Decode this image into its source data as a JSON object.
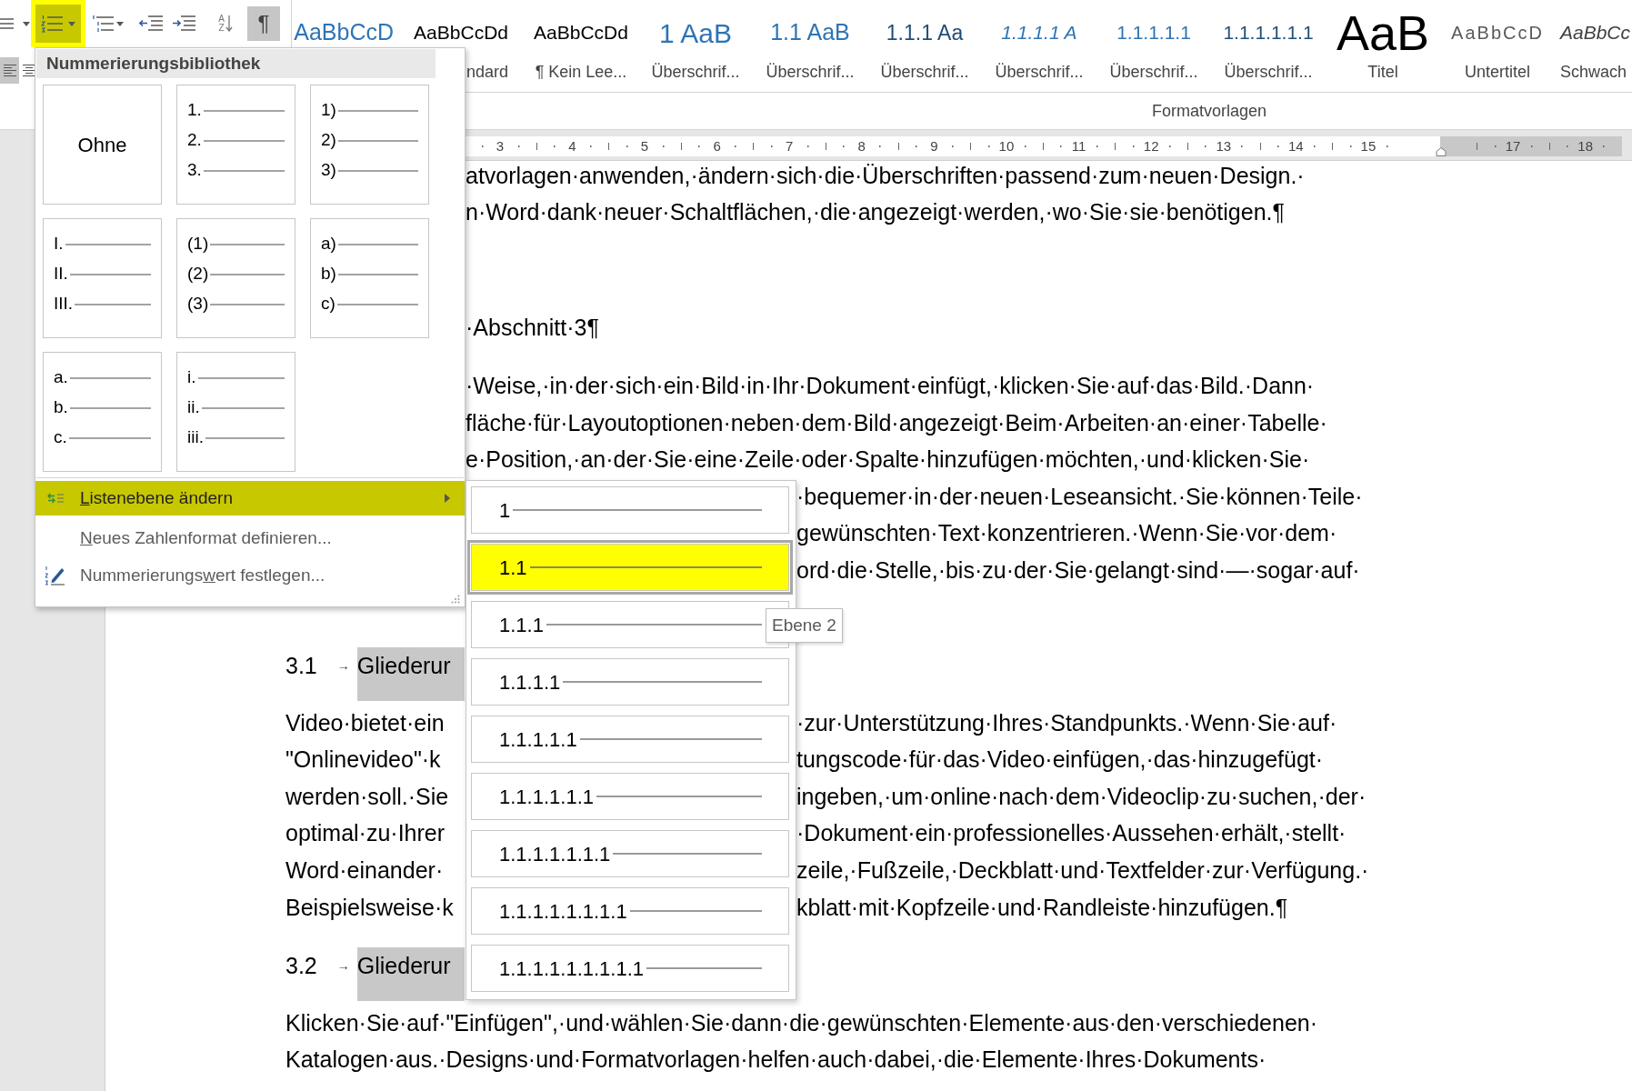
{
  "ribbon": {
    "row_1": [
      {
        "kind": "bullets",
        "on": false
      },
      {
        "kind": "numbering",
        "on": true
      },
      {
        "kind": "multilevel",
        "on": false
      },
      {
        "kind": "decrease-indent",
        "on": false
      },
      {
        "kind": "increase-indent",
        "on": false
      },
      {
        "kind": "sort",
        "on": false,
        "letters": [
          "A",
          "Z"
        ]
      },
      {
        "kind": "show-marks",
        "on": true,
        "glyph": "¶"
      }
    ],
    "row_2": [
      {
        "kind": "align-left",
        "on": true
      },
      {
        "kind": "align-center",
        "on": false
      }
    ],
    "styles": [
      {
        "kind": "accent-light",
        "preview": "AaBbCcD",
        "selected": false
      },
      {
        "kind": "body",
        "preview": "AaBbCcDd",
        "label": "ndard",
        "selected": false
      },
      {
        "kind": "body",
        "preview": "AaBbCcDd",
        "label": "¶ Kein Lee...",
        "selected": false
      },
      {
        "kind": "heading-1",
        "preview": "1 AaB",
        "label": "Überschrif...",
        "selected": false
      },
      {
        "kind": "heading-2",
        "preview": "1.1 AaB",
        "label": "Überschrif...",
        "selected": false
      },
      {
        "kind": "heading-3",
        "preview": "1.1.1 Aa",
        "label": "Überschrif...",
        "selected": false
      },
      {
        "kind": "heading-4",
        "preview": "1.1.1.1 A",
        "label": "Überschrif...",
        "selected": false
      },
      {
        "kind": "heading-5",
        "preview": "1.1.1.1.1",
        "label": "Überschrif...",
        "selected": false
      },
      {
        "kind": "heading-6",
        "preview": "1.1.1.1.1.1",
        "label": "Überschrif...",
        "selected": false
      },
      {
        "kind": "title",
        "preview": "AaB",
        "label": "Titel",
        "selected": false
      },
      {
        "kind": "subtitle",
        "preview": "AaBbCcD",
        "label": "Untertitel",
        "selected": false
      },
      {
        "kind": "subtle-emphasis",
        "preview": "AaBbCc",
        "label": "Schwach",
        "selected": false
      }
    ],
    "group_label": "Formatvorlagen"
  },
  "ruler": {
    "marks": [
      {
        "kind": "number",
        "label": "3",
        "margin": false
      },
      {
        "kind": "number",
        "label": "4",
        "margin": false
      },
      {
        "kind": "number",
        "label": "5",
        "margin": false
      },
      {
        "kind": "number",
        "label": "6",
        "margin": false
      },
      {
        "kind": "number",
        "label": "7",
        "margin": false
      },
      {
        "kind": "number",
        "label": "8",
        "margin": false
      },
      {
        "kind": "number",
        "label": "9",
        "margin": false
      },
      {
        "kind": "number",
        "label": "10",
        "margin": false
      },
      {
        "kind": "number",
        "label": "11",
        "margin": false
      },
      {
        "kind": "number",
        "label": "12",
        "margin": false
      },
      {
        "kind": "number",
        "label": "13",
        "margin": false
      },
      {
        "kind": "number",
        "label": "14",
        "margin": false
      },
      {
        "kind": "number",
        "label": "15",
        "margin": false
      },
      {
        "kind": "indent-marker",
        "margin": true
      },
      {
        "kind": "number",
        "label": "17",
        "margin": true
      },
      {
        "kind": "number",
        "label": "18",
        "margin": true
      }
    ]
  },
  "document": {
    "blocks": [
      {
        "kind": "paragraph",
        "lines": [
          {
            "right": "atvorlagen·anwenden,·ändern·sich·die·Überschriften·passend·zum·neuen·Design.·"
          },
          {
            "right": "n·Word·dank·neuer·Schaltflächen,·die·angezeigt·werden,·wo·Sie·sie·benötigen.¶"
          }
        ]
      },
      {
        "kind": "heading",
        "lines": [
          {
            "right": "·Abschnitt·3¶"
          }
        ]
      },
      {
        "kind": "paragraph",
        "lines": [
          {
            "right": "·Weise,·in·der·sich·ein·Bild·in·Ihr·Dokument·einfügt,·klicken·Sie·auf·das·Bild.·Dann·"
          },
          {
            "right": "fläche·für·Layoutoptionen·neben·dem·Bild·angezeigt·Beim·Arbeiten·an·einer·Tabelle·"
          },
          {
            "right": "e·Position,·an·der·Sie·eine·Zeile·oder·Spalte·hinzufügen·möchten,·und·klicken·Sie·"
          },
          {
            "right": "·bequemer·in·der·neuen·Leseansicht.·Sie·können·Teile·"
          },
          {
            "right": "gewünschten·Text·konzentrieren.·Wenn·Sie·vor·dem·"
          },
          {
            "right": "ord·die·Stelle,·bis·zu·der·Sie·gelangt·sind·—·sogar·auf·"
          }
        ]
      },
      {
        "kind": "heading",
        "number": "3.1",
        "tab": "→",
        "title": "Gliederur"
      },
      {
        "kind": "paragraph",
        "lines": [
          {
            "left": "Video·bietet·ein",
            "right": "·zur·Unterstützung·Ihres·Standpunkts.·Wenn·Sie·auf·"
          },
          {
            "left": "\"Onlinevideo\"·k",
            "right": "tungscode·für·das·Video·einfügen,·das·hinzugefügt·"
          },
          {
            "left": "werden·soll.·Sie",
            "right": "ingeben,·um·online·nach·dem·Videoclip·zu·suchen,·der·"
          },
          {
            "left": "optimal·zu·Ihrer",
            "right": "·Dokument·ein·professionelles·Aussehen·erhält,·stellt·"
          },
          {
            "left": "Word·einander·",
            "right": "zeile,·Fußzeile,·Deckblatt·und·Textfelder·zur·Verfügung.·"
          },
          {
            "left": "Beispielsweise·k",
            "right": "kblatt·mit·Kopfzeile·und·Randleiste·hinzufügen.¶"
          }
        ]
      },
      {
        "kind": "heading",
        "number": "3.2",
        "tab": "→",
        "title": "Gliederur"
      },
      {
        "kind": "paragraph",
        "lines": [
          {
            "left": "Klicken·Sie·auf·\"Einfügen\",·und·wählen·Sie·dann·die·gewünschten·Elemente·aus·den·verschiedenen·"
          },
          {
            "left": "Katalogen·aus.·Designs·und·Formatvorlagen·helfen·auch·dabei,·die·Elemente·Ihres·Dokuments·"
          }
        ]
      }
    ]
  },
  "numbering_menu": {
    "title": "Nummerierungsbibliothek",
    "tiles": [
      {
        "kind": "none",
        "label": "Ohne",
        "selected": false
      },
      {
        "kind": "list",
        "markers": [
          "1.",
          "2.",
          "3."
        ],
        "selected": false
      },
      {
        "kind": "list",
        "markers": [
          "1)",
          "2)",
          "3)"
        ],
        "selected": false
      },
      {
        "kind": "list",
        "markers": [
          "I.",
          "II.",
          "III."
        ],
        "selected": false
      },
      {
        "kind": "list",
        "markers": [
          "(1)",
          "(2)",
          "(3)"
        ],
        "selected": false
      },
      {
        "kind": "list",
        "markers": [
          "a)",
          "b)",
          "c)"
        ],
        "selected": false
      },
      {
        "kind": "list",
        "markers": [
          "a.",
          "b.",
          "c."
        ],
        "selected": false
      },
      {
        "kind": "list",
        "markers": [
          "i.",
          "ii.",
          "iii."
        ],
        "selected": false
      }
    ],
    "items": [
      {
        "kind": "change-level",
        "selected": true,
        "parts": [
          {
            "text": "L",
            "underline": true
          },
          {
            "text": "istenebene ändern",
            "underline": false
          }
        ]
      },
      {
        "kind": "define-format",
        "selected": false,
        "parts": [
          {
            "text": "N",
            "underline": true
          },
          {
            "text": "eues Zahlenformat definieren...",
            "underline": false
          }
        ]
      },
      {
        "kind": "set-value",
        "selected": false,
        "parts": [
          {
            "text": "Nummerierungs",
            "underline": false
          },
          {
            "text": "w",
            "underline": true
          },
          {
            "text": "ert festlegen...",
            "underline": false
          }
        ]
      }
    ]
  },
  "level_submenu": {
    "items": [
      {
        "label": "1",
        "selected": false
      },
      {
        "label": "1.1",
        "selected": true
      },
      {
        "label": "1.1.1",
        "selected": false
      },
      {
        "label": "1.1.1.1",
        "selected": false
      },
      {
        "label": "1.1.1.1.1",
        "selected": false
      },
      {
        "label": "1.1.1.1.1.1",
        "selected": false
      },
      {
        "label": "1.1.1.1.1.1.1",
        "selected": false
      },
      {
        "label": "1.1.1.1.1.1.1.1",
        "selected": false
      },
      {
        "label": "1.1.1.1.1.1.1.1.1",
        "selected": false
      }
    ]
  },
  "tooltip": {
    "text": "Ebene 2"
  }
}
